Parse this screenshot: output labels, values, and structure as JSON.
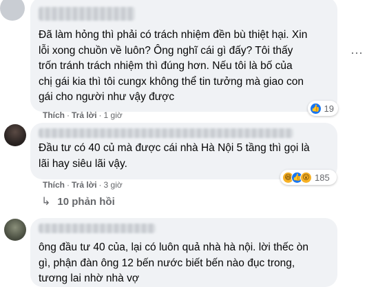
{
  "comments": [
    {
      "text": "Đã làm hỏng thì phải có trách nhiệm đền bù thiệt hại. Xin\nlỗi xong chuồn về luôn? Ông nghĩ cái gì đấy? Tôi thấy\ntrốn tránh trách nhiệm thì đúng hơn. Nếu tôi là bố của\nchị gái kia thì tôi cungx không thể tin tưởng mà giao con\ngái cho người như vậy được",
      "like_label": "Thích",
      "reply_label": "Trả lời",
      "time": "1 giờ",
      "reaction_count": "19"
    },
    {
      "text": "Đầu tư có 40 củ mà được cái nhà Hà Nội 5 tầng thì gọi là\nlãi hay siêu lãi vậy.",
      "like_label": "Thích",
      "reply_label": "Trả lời",
      "time": "3 giờ",
      "reaction_count": "185",
      "replies_label": "10 phản hồi"
    },
    {
      "text": "ông đầu tư 40 của, lại có luôn quả nhà hà nội. lời thếc òn\ngì, phận đàn ông 12 bến nước biết bến nào đục trong,\ntương lai nhờ nhà vợ"
    }
  ],
  "separator": "·",
  "more_icon": "···"
}
